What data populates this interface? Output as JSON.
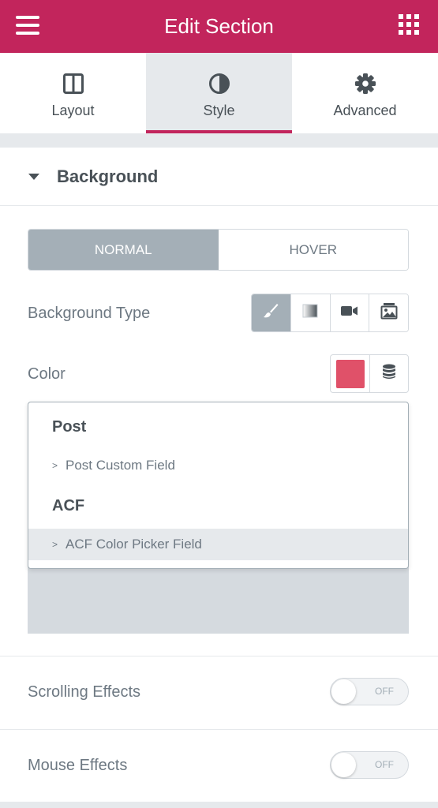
{
  "header": {
    "title": "Edit Section",
    "menu_icon": "hamburger-icon",
    "apps_icon": "grid-icon"
  },
  "tabs": [
    {
      "label": "Layout",
      "icon": "columns-icon"
    },
    {
      "label": "Style",
      "icon": "half-circle-icon"
    },
    {
      "label": "Advanced",
      "icon": "gear-icon"
    }
  ],
  "active_tab": "Style",
  "section": {
    "title": "Background",
    "expanded": true
  },
  "state_switch": {
    "normal": "NORMAL",
    "hover": "HOVER",
    "selected": "NORMAL"
  },
  "background_type": {
    "label": "Background Type",
    "options": [
      "brush-icon",
      "gradient-icon",
      "video-icon",
      "slideshow-icon"
    ],
    "selected": "brush-icon"
  },
  "color": {
    "label": "Color",
    "value": "#e05169",
    "dynamic_icon": "database-icon"
  },
  "dropdown": {
    "groups": [
      {
        "title": "Post",
        "items": [
          {
            "prefix": ">",
            "label": "Post Custom Field"
          }
        ]
      },
      {
        "title": "ACF",
        "items": [
          {
            "prefix": ">",
            "label": "ACF Color Picker Field"
          }
        ]
      }
    ],
    "highlighted": "ACF Color Picker Field"
  },
  "scrolling_effects": {
    "label": "Scrolling Effects",
    "state": "OFF"
  },
  "mouse_effects": {
    "label": "Mouse Effects",
    "state": "OFF"
  },
  "colors": {
    "brand": "#c2255c",
    "active_button": "#a4afb7",
    "text": "#495157"
  }
}
